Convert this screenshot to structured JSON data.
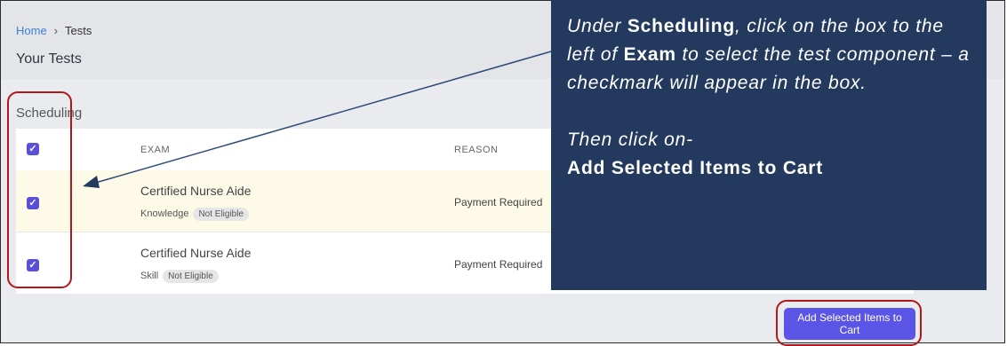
{
  "breadcrumb": {
    "home": "Home",
    "separator": "›",
    "current": "Tests"
  },
  "page": {
    "title": "Your Tests"
  },
  "section": {
    "label": "Scheduling"
  },
  "table": {
    "columns": {
      "exam": "EXAM",
      "reason": "REASON"
    },
    "rows": [
      {
        "name": "Certified Nurse Aide",
        "component": "Knowledge",
        "badge": "Not Eligible",
        "reason": "Payment Required",
        "checked": true
      },
      {
        "name": "Certified Nurse Aide",
        "component": "Skill",
        "badge": "Not Eligible",
        "reason": "Payment Required",
        "checked": true
      }
    ]
  },
  "checkmark": "✓",
  "actions": {
    "add_to_cart": "Add Selected Items to Cart"
  },
  "callout": {
    "p1_a": "Under ",
    "p1_b": "Scheduling",
    "p1_c": ", click on the box to the left of ",
    "p1_d": "Exam",
    "p1_e": " to select the test component – a checkmark will appear in the box.",
    "p2_a": "Then click on-",
    "p2_b": "Add Selected Items to Cart"
  },
  "colors": {
    "accent": "#5a55e6",
    "callout_bg": "#233a5e",
    "highlight": "#b3171b",
    "row_highlight": "#fdfbe8"
  }
}
